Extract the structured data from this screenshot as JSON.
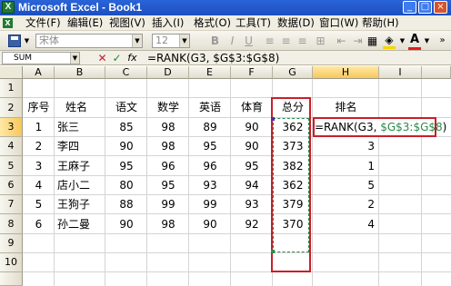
{
  "window": {
    "title": "Microsoft Excel - Book1",
    "app_icon": "X"
  },
  "window_buttons": [
    {
      "icon": "minimize-icon",
      "glyph": "_"
    },
    {
      "icon": "maximize-icon",
      "glyph": "□"
    },
    {
      "icon": "close-icon",
      "glyph": "×"
    }
  ],
  "menu": [
    "文件(F)",
    "编辑(E)",
    "视图(V)",
    "插入(I)",
    "格式(O)",
    "工具(T)",
    "数据(D)",
    "窗口(W)",
    "帮助(H)"
  ],
  "toolbar": {
    "font_name": "宋体",
    "font_size": "12",
    "bold": "B",
    "italic": "I",
    "underline": "U",
    "font_color_glyph": "A"
  },
  "formula_bar": {
    "name_box": "SUM",
    "cancel_glyph": "✕",
    "enter_glyph": "✓",
    "fx": "fx",
    "formula": "=RANK(G3, $G$3:$G$8)"
  },
  "columns": [
    "A",
    "B",
    "C",
    "D",
    "E",
    "F",
    "G",
    "H",
    "I"
  ],
  "rows": [
    "1",
    "2",
    "3",
    "4",
    "5",
    "6",
    "7",
    "8",
    "9",
    "10"
  ],
  "headers": {
    "seq": "序号",
    "name": "姓名",
    "chinese": "语文",
    "math": "数学",
    "english": "英语",
    "pe": "体育",
    "total": "总分",
    "rank": "排名"
  },
  "records": [
    {
      "seq": "1",
      "name": "张三",
      "chinese": "85",
      "math": "98",
      "english": "89",
      "pe": "90",
      "total": "362",
      "rank": ""
    },
    {
      "seq": "2",
      "name": "李四",
      "chinese": "90",
      "math": "98",
      "english": "95",
      "pe": "90",
      "total": "373",
      "rank": "3"
    },
    {
      "seq": "3",
      "name": "王麻子",
      "chinese": "95",
      "math": "96",
      "english": "96",
      "pe": "95",
      "total": "382",
      "rank": "1"
    },
    {
      "seq": "4",
      "name": "店小二",
      "chinese": "80",
      "math": "95",
      "english": "93",
      "pe": "94",
      "total": "362",
      "rank": "5"
    },
    {
      "seq": "5",
      "name": "王狗子",
      "chinese": "88",
      "math": "99",
      "english": "99",
      "pe": "93",
      "total": "379",
      "rank": "2"
    },
    {
      "seq": "6",
      "name": "孙二曼",
      "chinese": "90",
      "math": "98",
      "english": "90",
      "pe": "92",
      "total": "370",
      "rank": "4"
    }
  ],
  "editing": {
    "prefix": "=RANK(G3, ",
    "ref": "$G$3:$G$8",
    "suffix": ")"
  },
  "colors": {
    "highlight_box": "#c8202a",
    "range_ref": "#2a8a4a",
    "titlebar": "#2a64d9"
  }
}
